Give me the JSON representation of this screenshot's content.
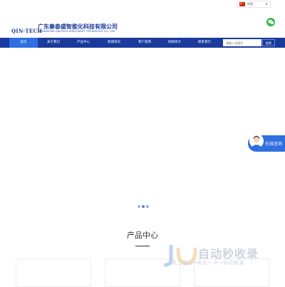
{
  "lang": {
    "label": "中文"
  },
  "header": {
    "logo": "QIN·TECH",
    "company_cn": "广东秦泰盛智能化科技有限公司",
    "company_en": "GUANGDONG QIN-TECH INTELLIGENT TECHNOLOGY CO., LTD."
  },
  "nav": {
    "items": [
      {
        "label": "首页"
      },
      {
        "label": "关于我们"
      },
      {
        "label": "产品中心"
      },
      {
        "label": "新闻资讯"
      },
      {
        "label": "客户案例"
      },
      {
        "label": "招纳贤才"
      },
      {
        "label": "联系我们"
      }
    ],
    "active_index": 0,
    "search_placeholder": "请输入关键字",
    "search_button": "搜索"
  },
  "slider": {
    "dot_count": 3,
    "active_index": 1
  },
  "section": {
    "title": "产品中心"
  },
  "consult": {
    "label": "在线咨询"
  },
  "watermark": {
    "title": "自动秒收录",
    "subtitle": "做上链接→来访一次→自动收录"
  },
  "colors": {
    "primary": "#1a3a9c",
    "nav_active": "#2f6fe0",
    "wechat": "#35b447"
  }
}
